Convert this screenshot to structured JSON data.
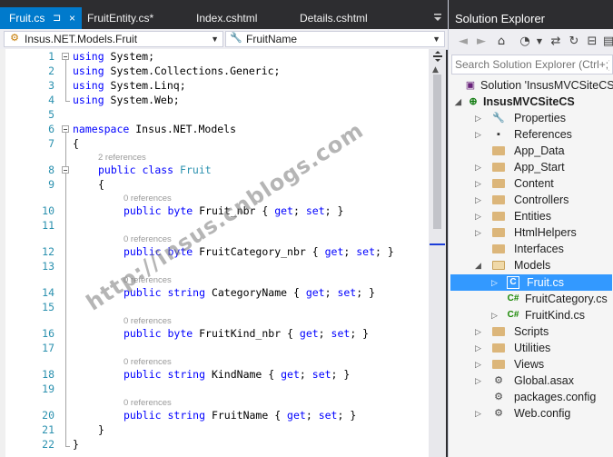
{
  "tabs": [
    {
      "label": "Fruit.cs",
      "active": true,
      "pin": "⊐",
      "close": "×"
    },
    {
      "label": "FruitEntity.cs*",
      "active": false
    },
    {
      "label": "Index.cshtml",
      "active": false
    },
    {
      "label": "Details.cshtml",
      "active": false
    }
  ],
  "navbar": {
    "type_combo": "Insus.NET.Models.Fruit",
    "member_combo": "FruitName"
  },
  "code": {
    "lines": {
      "1": "using System;",
      "2": "using System.Collections.Generic;",
      "3": "using System.Linq;",
      "4": "using System.Web;",
      "5": "",
      "6": "namespace Insus.NET.Models",
      "7": "{",
      "8": "public class Fruit",
      "9": "{",
      "10": "public byte Fruit_nbr { get; set; }",
      "11": "",
      "12": "public byte FruitCategory_nbr { get; set; }",
      "13": "",
      "14": "public string CategoryName { get; set; }",
      "15": "",
      "16": "public byte FruitKind_nbr { get; set; }",
      "17": "",
      "18": "public string KindName { get; set; }",
      "19": "",
      "20": "public string FruitName { get; set; }",
      "21": "}",
      "22": "}"
    },
    "refs": {
      "class": "2 references",
      "prop": "0 references"
    },
    "line_numbers": [
      "1",
      "2",
      "3",
      "4",
      "5",
      "6",
      "7",
      "8",
      "9",
      "10",
      "11",
      "12",
      "13",
      "14",
      "15",
      "16",
      "17",
      "18",
      "19",
      "20",
      "21",
      "22"
    ]
  },
  "watermark": "http://insus.cnblogs.com",
  "solution_explorer": {
    "title": "Solution Explorer",
    "search_placeholder": "Search Solution Explorer (Ctrl+;)",
    "solution_label": "Solution 'InsusMVCSiteCS' (",
    "project_label": "InsusMVCSiteCS",
    "items": [
      "Properties",
      "References",
      "App_Data",
      "App_Start",
      "Content",
      "Controllers",
      "Entities",
      "HtmlHelpers",
      "Interfaces",
      "Models"
    ],
    "models_children": [
      "Fruit.cs",
      "FruitCategory.cs",
      "FruitKind.cs"
    ],
    "tail_items": [
      "Scripts",
      "Utilities",
      "Views",
      "Global.asax",
      "packages.config",
      "Web.config"
    ]
  },
  "colors": {
    "accent": "#007acc",
    "selection": "#3399ff",
    "keyword": "#0000ff",
    "type": "#2b91af"
  }
}
